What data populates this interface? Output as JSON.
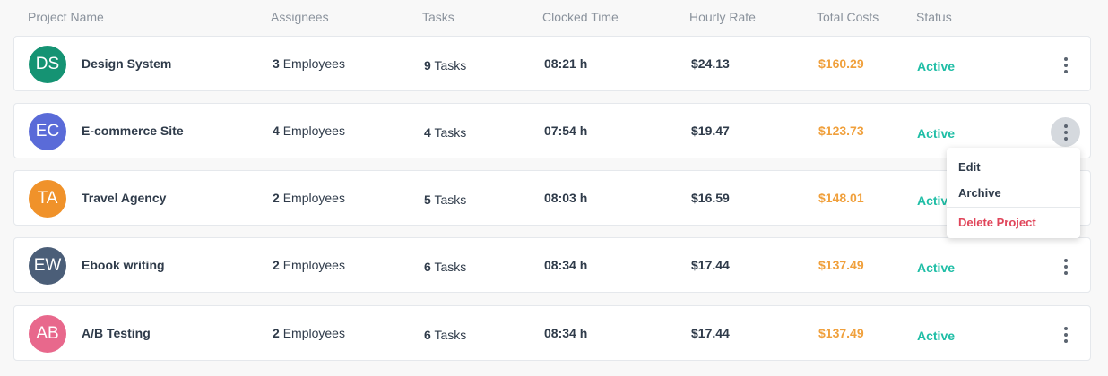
{
  "header": {
    "project_name": "Project Name",
    "assignees": "Assignees",
    "tasks": "Tasks",
    "clocked_time": "Clocked Time",
    "hourly_rate": "Hourly Rate",
    "total_costs": "Total Costs",
    "status": "Status"
  },
  "rows": [
    {
      "initials": "DS",
      "avatar_color": "#159373",
      "name": "Design System",
      "assignee_count": "3",
      "assignee_unit": "Employees",
      "task_count": "9",
      "task_unit": "Tasks",
      "clocked_time": "08:21 h",
      "hourly_rate": "$24.13",
      "total_cost": "$160.29",
      "status": "Active"
    },
    {
      "initials": "EC",
      "avatar_color": "#5a6bd8",
      "name": "E-commerce Site",
      "assignee_count": "4",
      "assignee_unit": "Employees",
      "task_count": "4",
      "task_unit": "Tasks",
      "clocked_time": "07:54 h",
      "hourly_rate": "$19.47",
      "total_cost": "$123.73",
      "status": "Active"
    },
    {
      "initials": "TA",
      "avatar_color": "#f0922a",
      "name": "Travel Agency",
      "assignee_count": "2",
      "assignee_unit": "Employees",
      "task_count": "5",
      "task_unit": "Tasks",
      "clocked_time": "08:03 h",
      "hourly_rate": "$16.59",
      "total_cost": "$148.01",
      "status": "Active"
    },
    {
      "initials": "EW",
      "avatar_color": "#4b5e78",
      "name": "Ebook writing",
      "assignee_count": "2",
      "assignee_unit": "Employees",
      "task_count": "6",
      "task_unit": "Tasks",
      "clocked_time": "08:34 h",
      "hourly_rate": "$17.44",
      "total_cost": "$137.49",
      "status": "Active"
    },
    {
      "initials": "AB",
      "avatar_color": "#e8688c",
      "name": "A/B Testing",
      "assignee_count": "2",
      "assignee_unit": "Employees",
      "task_count": "6",
      "task_unit": "Tasks",
      "clocked_time": "08:34 h",
      "hourly_rate": "$17.44",
      "total_cost": "$137.49",
      "status": "Active"
    }
  ],
  "row_menu_icon": "more-vertical-icon",
  "active_menu_row": 1,
  "dropdown": {
    "edit": "Edit",
    "archive": "Archive",
    "delete": "Delete Project"
  },
  "colors": {
    "cost": "#f0a03c",
    "status_active": "#1fbea6",
    "delete": "#e0455a"
  }
}
